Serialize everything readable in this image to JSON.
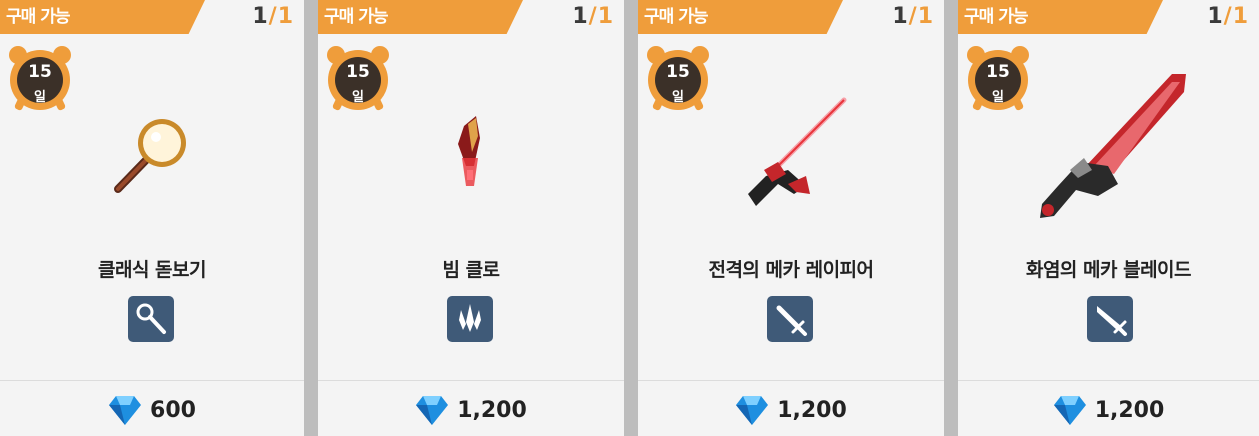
{
  "cards": [
    {
      "badge": "구매 가능",
      "count_current": "1",
      "count_sep": "/",
      "count_max": "1",
      "timer_value": "15",
      "timer_unit": "일",
      "name": "클래식 돋보기",
      "type_icon": "magnifier-weapon-icon",
      "price": "600",
      "currency_icon": "blue-gem-icon"
    },
    {
      "badge": "구매 가능",
      "count_current": "1",
      "count_sep": "/",
      "count_max": "1",
      "timer_value": "15",
      "timer_unit": "일",
      "name": "빔 클로",
      "type_icon": "claw-weapon-icon",
      "price": "1,200",
      "currency_icon": "blue-gem-icon"
    },
    {
      "badge": "구매 가능",
      "count_current": "1",
      "count_sep": "/",
      "count_max": "1",
      "timer_value": "15",
      "timer_unit": "일",
      "name": "전격의 메카 레이피어",
      "type_icon": "sword-weapon-icon",
      "price": "1,200",
      "currency_icon": "blue-gem-icon"
    },
    {
      "badge": "구매 가능",
      "count_current": "1",
      "count_sep": "/",
      "count_max": "1",
      "timer_value": "15",
      "timer_unit": "일",
      "name": "화염의 메카 블레이드",
      "type_icon": "blade-weapon-icon",
      "price": "1,200",
      "currency_icon": "blue-gem-icon"
    }
  ],
  "colors": {
    "badge": "#ef9d3b",
    "timer": "#3b3028",
    "icon_bg": "#3f5a78",
    "gem": "#1e8fe0"
  }
}
